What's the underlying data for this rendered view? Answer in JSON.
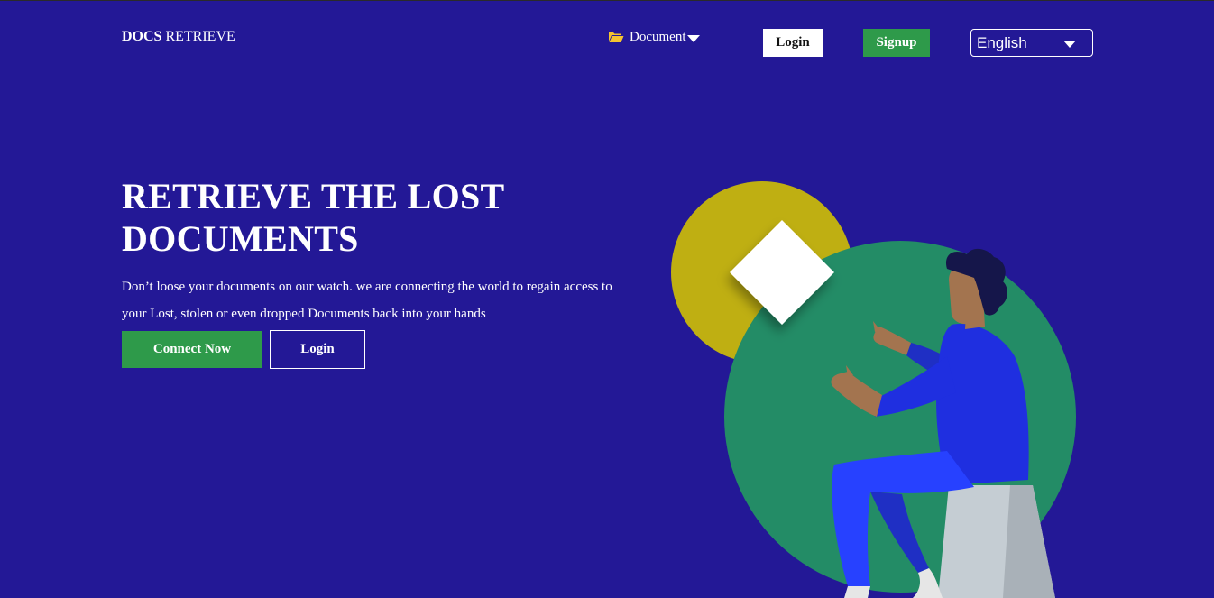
{
  "header": {
    "brand_bold": "DOCS",
    "brand_rest": " RETRIEVE",
    "document_menu_label": "Document",
    "login_label": "Login",
    "signup_label": "Signup",
    "language_selected": "English"
  },
  "hero": {
    "title": "RETRIEVE THE LOST DOCUMENTS",
    "description": "Don’t loose your documents on our watch. we are connecting the world to regain access to your Lost, stolen or even dropped Documents back into your hands",
    "connect_label": "Connect Now",
    "login_label": "Login"
  },
  "colors": {
    "background": "#231896",
    "accent_green": "#2e9a4a",
    "circle_yellow": "#bfaf12",
    "circle_green": "#238c66",
    "folder_icon": "#f4c430"
  },
  "icons": {
    "folder": "folder-open-icon",
    "document_dropdown": "caret-down-icon",
    "language_dropdown": "caret-down-icon"
  }
}
